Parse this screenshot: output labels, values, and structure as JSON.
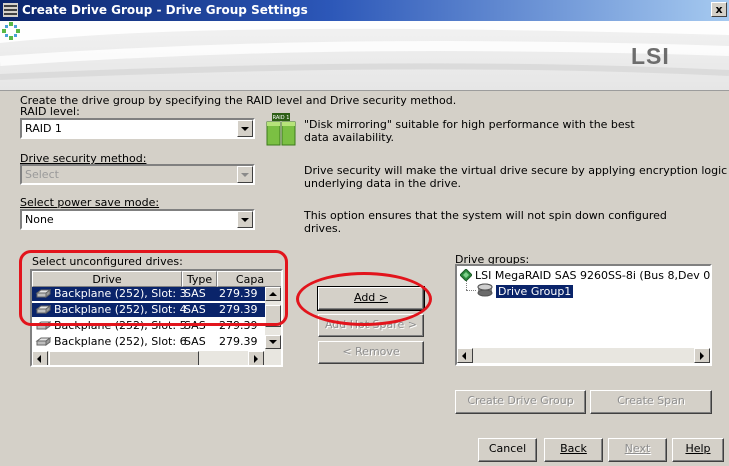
{
  "window": {
    "title": "Create Drive Group - Drive Group Settings",
    "close_glyph": "x"
  },
  "banner": {
    "logo_text": "LSI"
  },
  "instructions": "Create the drive group by specifying the RAID level and Drive security method.",
  "raid": {
    "label": "RAID level:",
    "value": "RAID 1",
    "badge": "RAID 1",
    "description_line1": "\"Disk mirroring\" suitable for high performance with the best",
    "description_line2": "data availability."
  },
  "security": {
    "label": "Drive security method:",
    "value": "Select",
    "description_line1": "Drive security will make the virtual drive secure by applying encryption logic to",
    "description_line2": "underlying data in the drive."
  },
  "power_save": {
    "label": "Select power save mode:",
    "value": "None",
    "description_line1": "This option ensures that the system will not spin down configured",
    "description_line2": "drives."
  },
  "drives": {
    "label": "Select unconfigured drives:",
    "columns": [
      "Drive",
      "Type",
      "Capa"
    ],
    "rows": [
      {
        "drive": "Backplane (252), Slot: 3",
        "type": "SAS",
        "capacity": "279.39",
        "selected": true
      },
      {
        "drive": "Backplane (252), Slot: 4",
        "type": "SAS",
        "capacity": "279.39",
        "selected": true
      },
      {
        "drive": "Backplane (252), Slot: 5",
        "type": "SAS",
        "capacity": "279.39",
        "selected": false
      },
      {
        "drive": "Backplane (252), Slot: 6",
        "type": "SAS",
        "capacity": "279.39",
        "selected": false
      }
    ]
  },
  "actions": {
    "add": "Add >",
    "add_hot_spare": "Add Hot Spare >",
    "remove": "< Remove"
  },
  "drive_groups": {
    "label": "Drive groups:",
    "controller": "LSI MegaRAID SAS 9260SS-8i (Bus 8,Dev 0",
    "group": "Drive Group1"
  },
  "group_buttons": {
    "create_drive_group": "Create Drive Group",
    "create_span": "Create Span"
  },
  "footer": {
    "cancel": "Cancel",
    "back": "Back",
    "next": "Next",
    "help": "Help"
  },
  "colors": {
    "annotation": "#e2141c",
    "selection": "#0a246a",
    "titlebar": "#0a246a"
  }
}
